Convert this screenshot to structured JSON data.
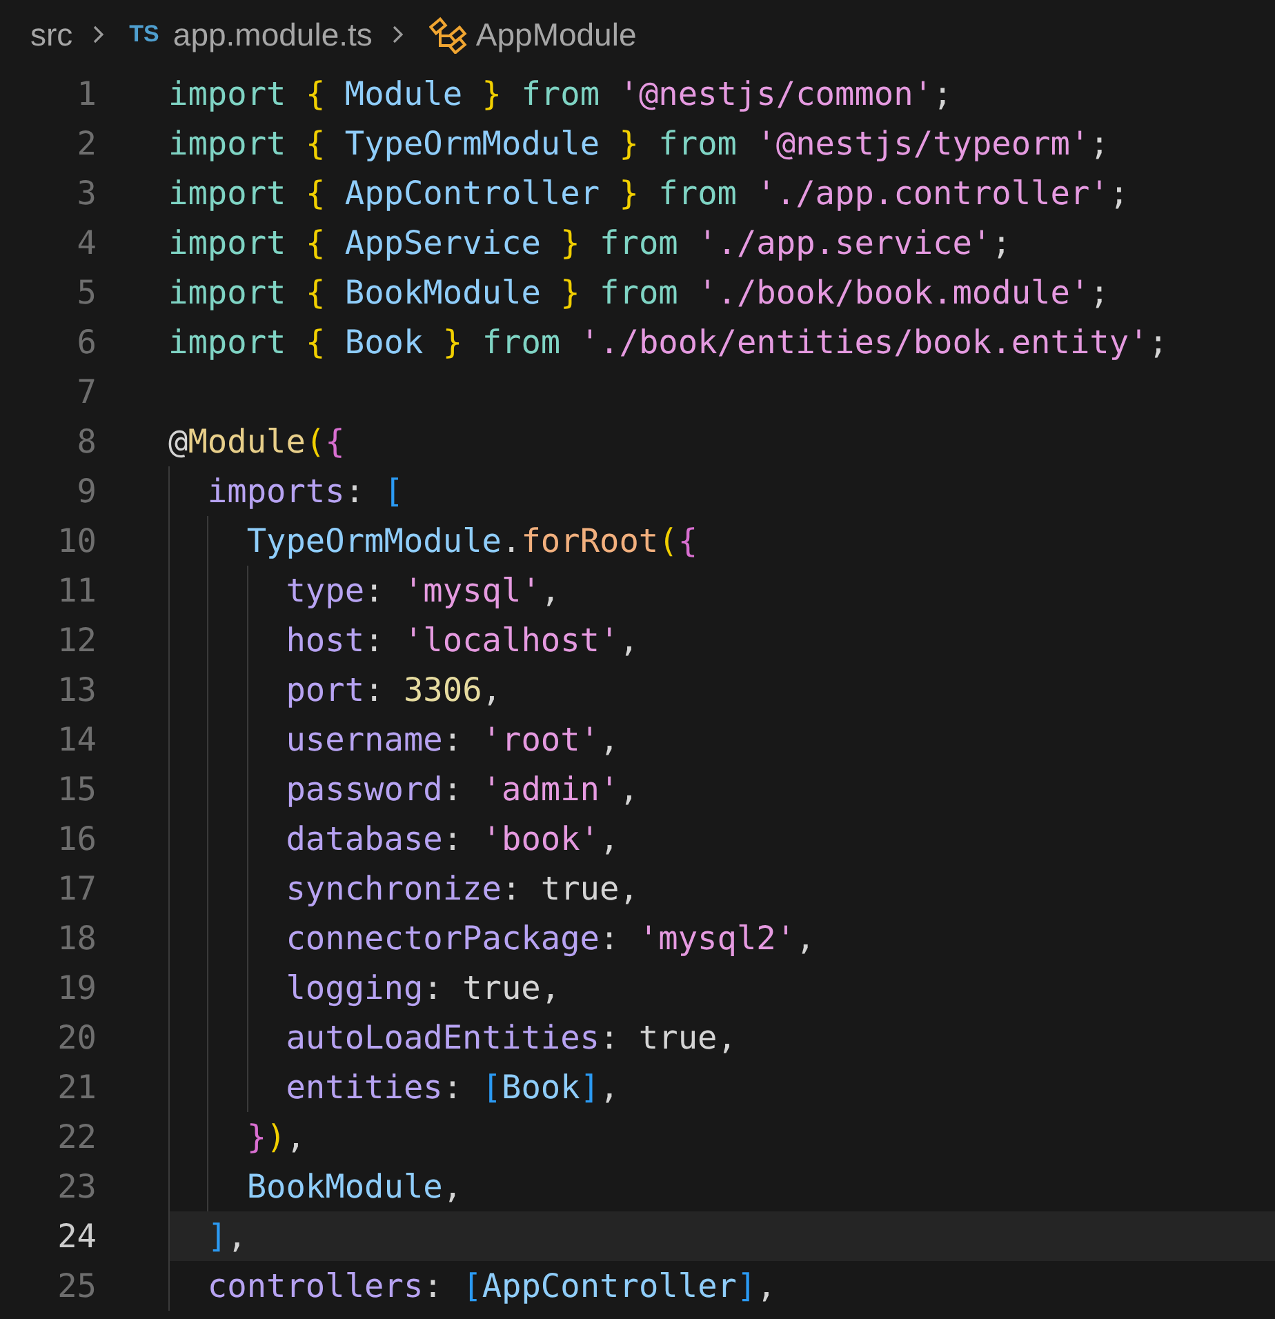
{
  "breadcrumb": [
    {
      "kind": "folder",
      "label": "src"
    },
    {
      "kind": "file",
      "badge": "TS",
      "label": "app.module.ts"
    },
    {
      "kind": "symbol",
      "label": "AppModule"
    }
  ],
  "lines": [
    {
      "number": "1",
      "selected": false,
      "tokens": [
        {
          "kind": "keyword",
          "text": "import "
        },
        {
          "kind": "brace1",
          "text": "{ "
        },
        {
          "kind": "type",
          "text": "Module"
        },
        {
          "kind": "brace1",
          "text": " }"
        },
        {
          "kind": "keyword",
          "text": " from "
        },
        {
          "kind": "string",
          "text": "'@nestjs/common'"
        },
        {
          "kind": "punct",
          "text": ";"
        }
      ]
    },
    {
      "number": "2",
      "selected": false,
      "tokens": [
        {
          "kind": "keyword",
          "text": "import "
        },
        {
          "kind": "brace1",
          "text": "{ "
        },
        {
          "kind": "type",
          "text": "TypeOrmModule"
        },
        {
          "kind": "brace1",
          "text": " }"
        },
        {
          "kind": "keyword",
          "text": " from "
        },
        {
          "kind": "string",
          "text": "'@nestjs/typeorm'"
        },
        {
          "kind": "punct",
          "text": ";"
        }
      ]
    },
    {
      "number": "3",
      "selected": false,
      "tokens": [
        {
          "kind": "keyword",
          "text": "import "
        },
        {
          "kind": "brace1",
          "text": "{ "
        },
        {
          "kind": "type",
          "text": "AppController"
        },
        {
          "kind": "brace1",
          "text": " }"
        },
        {
          "kind": "keyword",
          "text": " from "
        },
        {
          "kind": "string",
          "text": "'./app.controller'"
        },
        {
          "kind": "punct",
          "text": ";"
        }
      ]
    },
    {
      "number": "4",
      "selected": false,
      "tokens": [
        {
          "kind": "keyword",
          "text": "import "
        },
        {
          "kind": "brace1",
          "text": "{ "
        },
        {
          "kind": "type",
          "text": "AppService"
        },
        {
          "kind": "brace1",
          "text": " }"
        },
        {
          "kind": "keyword",
          "text": " from "
        },
        {
          "kind": "string",
          "text": "'./app.service'"
        },
        {
          "kind": "punct",
          "text": ";"
        }
      ]
    },
    {
      "number": "5",
      "selected": false,
      "tokens": [
        {
          "kind": "keyword",
          "text": "import "
        },
        {
          "kind": "brace1",
          "text": "{ "
        },
        {
          "kind": "type",
          "text": "BookModule"
        },
        {
          "kind": "brace1",
          "text": " }"
        },
        {
          "kind": "keyword",
          "text": " from "
        },
        {
          "kind": "string",
          "text": "'./book/book.module'"
        },
        {
          "kind": "punct",
          "text": ";"
        }
      ]
    },
    {
      "number": "6",
      "selected": false,
      "tokens": [
        {
          "kind": "keyword",
          "text": "import "
        },
        {
          "kind": "brace1",
          "text": "{ "
        },
        {
          "kind": "type",
          "text": "Book"
        },
        {
          "kind": "brace1",
          "text": " }"
        },
        {
          "kind": "keyword",
          "text": " from "
        },
        {
          "kind": "string",
          "text": "'./book/entities/book.entity'"
        },
        {
          "kind": "punct",
          "text": ";"
        }
      ]
    },
    {
      "number": "7",
      "selected": false
    },
    {
      "number": "8",
      "selected": false,
      "tokens": [
        {
          "kind": "punct",
          "text": "@"
        },
        {
          "kind": "decorator",
          "text": "Module"
        },
        {
          "kind": "brace1",
          "text": "("
        },
        {
          "kind": "brace2",
          "text": "{"
        }
      ],
      "children": [
        {
          "number": "9",
          "selected": false,
          "tokens": [
            {
              "kind": "property",
              "text": "imports"
            },
            {
              "kind": "punct",
              "text": ": "
            },
            {
              "kind": "brace3",
              "text": "["
            }
          ],
          "children": [
            {
              "number": "10",
              "selected": false,
              "tokens": [
                {
                  "kind": "type",
                  "text": "TypeOrmModule"
                },
                {
                  "kind": "punct",
                  "text": "."
                },
                {
                  "kind": "function",
                  "text": "forRoot"
                },
                {
                  "kind": "brace1",
                  "text": "("
                },
                {
                  "kind": "brace2",
                  "text": "{"
                }
              ],
              "children": [
                {
                  "number": "11",
                  "selected": false,
                  "tokens": [
                    {
                      "kind": "property",
                      "text": "type"
                    },
                    {
                      "kind": "punct",
                      "text": ": "
                    },
                    {
                      "kind": "string",
                      "text": "'mysql'"
                    },
                    {
                      "kind": "punct",
                      "text": ","
                    }
                  ]
                },
                {
                  "number": "12",
                  "selected": false,
                  "tokens": [
                    {
                      "kind": "property",
                      "text": "host"
                    },
                    {
                      "kind": "punct",
                      "text": ": "
                    },
                    {
                      "kind": "string",
                      "text": "'localhost'"
                    },
                    {
                      "kind": "punct",
                      "text": ","
                    }
                  ]
                },
                {
                  "number": "13",
                  "selected": false,
                  "tokens": [
                    {
                      "kind": "property",
                      "text": "port"
                    },
                    {
                      "kind": "punct",
                      "text": ": "
                    },
                    {
                      "kind": "number",
                      "text": "3306"
                    },
                    {
                      "kind": "punct",
                      "text": ","
                    }
                  ]
                },
                {
                  "number": "14",
                  "selected": false,
                  "tokens": [
                    {
                      "kind": "property",
                      "text": "username"
                    },
                    {
                      "kind": "punct",
                      "text": ": "
                    },
                    {
                      "kind": "string",
                      "text": "'root'"
                    },
                    {
                      "kind": "punct",
                      "text": ","
                    }
                  ]
                },
                {
                  "number": "15",
                  "selected": false,
                  "tokens": [
                    {
                      "kind": "property",
                      "text": "password"
                    },
                    {
                      "kind": "punct",
                      "text": ": "
                    },
                    {
                      "kind": "string",
                      "text": "'admin'"
                    },
                    {
                      "kind": "punct",
                      "text": ","
                    }
                  ]
                },
                {
                  "number": "16",
                  "selected": false,
                  "tokens": [
                    {
                      "kind": "property",
                      "text": "database"
                    },
                    {
                      "kind": "punct",
                      "text": ": "
                    },
                    {
                      "kind": "string",
                      "text": "'book'"
                    },
                    {
                      "kind": "punct",
                      "text": ","
                    }
                  ]
                },
                {
                  "number": "17",
                  "selected": false,
                  "tokens": [
                    {
                      "kind": "property",
                      "text": "synchronize"
                    },
                    {
                      "kind": "punct",
                      "text": ": true,"
                    }
                  ]
                },
                {
                  "number": "18",
                  "selected": false,
                  "tokens": [
                    {
                      "kind": "property",
                      "text": "connectorPackage"
                    },
                    {
                      "kind": "punct",
                      "text": ": "
                    },
                    {
                      "kind": "string",
                      "text": "'mysql2'"
                    },
                    {
                      "kind": "punct",
                      "text": ","
                    }
                  ]
                },
                {
                  "number": "19",
                  "selected": false,
                  "tokens": [
                    {
                      "kind": "property",
                      "text": "logging"
                    },
                    {
                      "kind": "punct",
                      "text": ": true,"
                    }
                  ]
                },
                {
                  "number": "20",
                  "selected": false,
                  "tokens": [
                    {
                      "kind": "property",
                      "text": "autoLoadEntities"
                    },
                    {
                      "kind": "punct",
                      "text": ": true,"
                    }
                  ]
                },
                {
                  "number": "21",
                  "selected": false,
                  "tokens": [
                    {
                      "kind": "property",
                      "text": "entities"
                    },
                    {
                      "kind": "punct",
                      "text": ": "
                    },
                    {
                      "kind": "brace3",
                      "text": "["
                    },
                    {
                      "kind": "type",
                      "text": "Book"
                    },
                    {
                      "kind": "brace3",
                      "text": "]"
                    },
                    {
                      "kind": "punct",
                      "text": ","
                    }
                  ]
                }
              ]
            },
            {
              "number": "22",
              "selected": false,
              "tokens": [
                {
                  "kind": "brace2",
                  "text": "}"
                },
                {
                  "kind": "brace1",
                  "text": ")"
                },
                {
                  "kind": "punct",
                  "text": ","
                }
              ]
            },
            {
              "number": "23",
              "selected": false,
              "tokens": [
                {
                  "kind": "type",
                  "text": "BookModule"
                },
                {
                  "kind": "punct",
                  "text": ","
                }
              ]
            }
          ]
        },
        {
          "number": "24",
          "selected": true,
          "tokens": [
            {
              "kind": "brace3",
              "text": "]"
            },
            {
              "kind": "punct",
              "text": ","
            }
          ]
        },
        {
          "number": "25",
          "selected": false,
          "tokens": [
            {
              "kind": "property",
              "text": "controllers"
            },
            {
              "kind": "punct",
              "text": ": "
            },
            {
              "kind": "brace3",
              "text": "["
            },
            {
              "kind": "type",
              "text": "AppController"
            },
            {
              "kind": "brace3",
              "text": "]"
            },
            {
              "kind": "punct",
              "text": ","
            }
          ]
        }
      ]
    }
  ]
}
